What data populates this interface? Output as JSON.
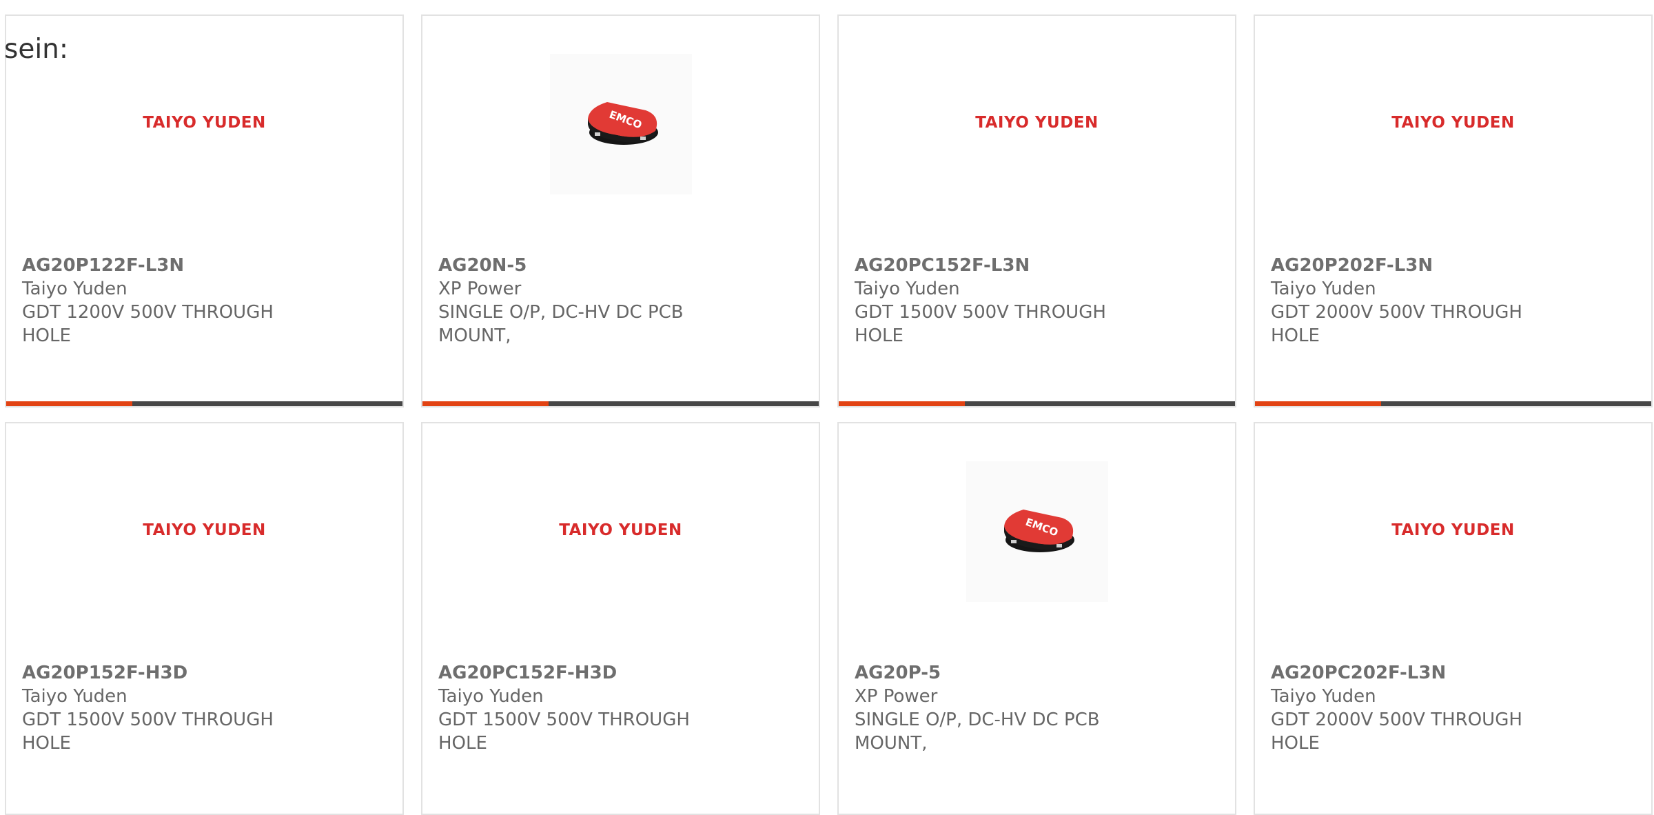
{
  "intro_text": "sein:",
  "colors": {
    "accent": "#e24313",
    "bar": "#474747",
    "brand_logo": "#d82b2b",
    "border": "#e2e2e2"
  },
  "products": [
    {
      "part": "AG20P122F-L3N",
      "manufacturer": "Taiyo Yuden",
      "description": "GDT 1200V 500V THROUGH HOLE",
      "image": "taiyo-yuden-logo",
      "logo_text": "TAIYO YUDEN"
    },
    {
      "part": "AG20N-5",
      "manufacturer": "XP Power",
      "description": "SINGLE O/P, DC-HV DC PCB MOUNT,",
      "image": "emco-module-photo",
      "logo_text": "EMCO"
    },
    {
      "part": "AG20PC152F-L3N",
      "manufacturer": "Taiyo Yuden",
      "description": "GDT 1500V 500V THROUGH HOLE",
      "image": "taiyo-yuden-logo",
      "logo_text": "TAIYO YUDEN"
    },
    {
      "part": "AG20P202F-L3N",
      "manufacturer": "Taiyo Yuden",
      "description": "GDT 2000V 500V THROUGH HOLE",
      "image": "taiyo-yuden-logo",
      "logo_text": "TAIYO YUDEN"
    },
    {
      "part": "AG20P152F-H3D",
      "manufacturer": "Taiyo Yuden",
      "description": "GDT 1500V 500V THROUGH HOLE",
      "image": "taiyo-yuden-logo",
      "logo_text": "TAIYO YUDEN"
    },
    {
      "part": "AG20PC152F-H3D",
      "manufacturer": "Taiyo Yuden",
      "description": "GDT 1500V 500V THROUGH HOLE",
      "image": "taiyo-yuden-logo",
      "logo_text": "TAIYO YUDEN"
    },
    {
      "part": "AG20P-5",
      "manufacturer": "XP Power",
      "description": "SINGLE O/P, DC-HV DC PCB MOUNT,",
      "image": "emco-module-photo",
      "logo_text": "EMCO"
    },
    {
      "part": "AG20PC202F-L3N",
      "manufacturer": "Taiyo Yuden",
      "description": "GDT 2000V 500V THROUGH HOLE",
      "image": "taiyo-yuden-logo",
      "logo_text": "TAIYO YUDEN"
    }
  ]
}
